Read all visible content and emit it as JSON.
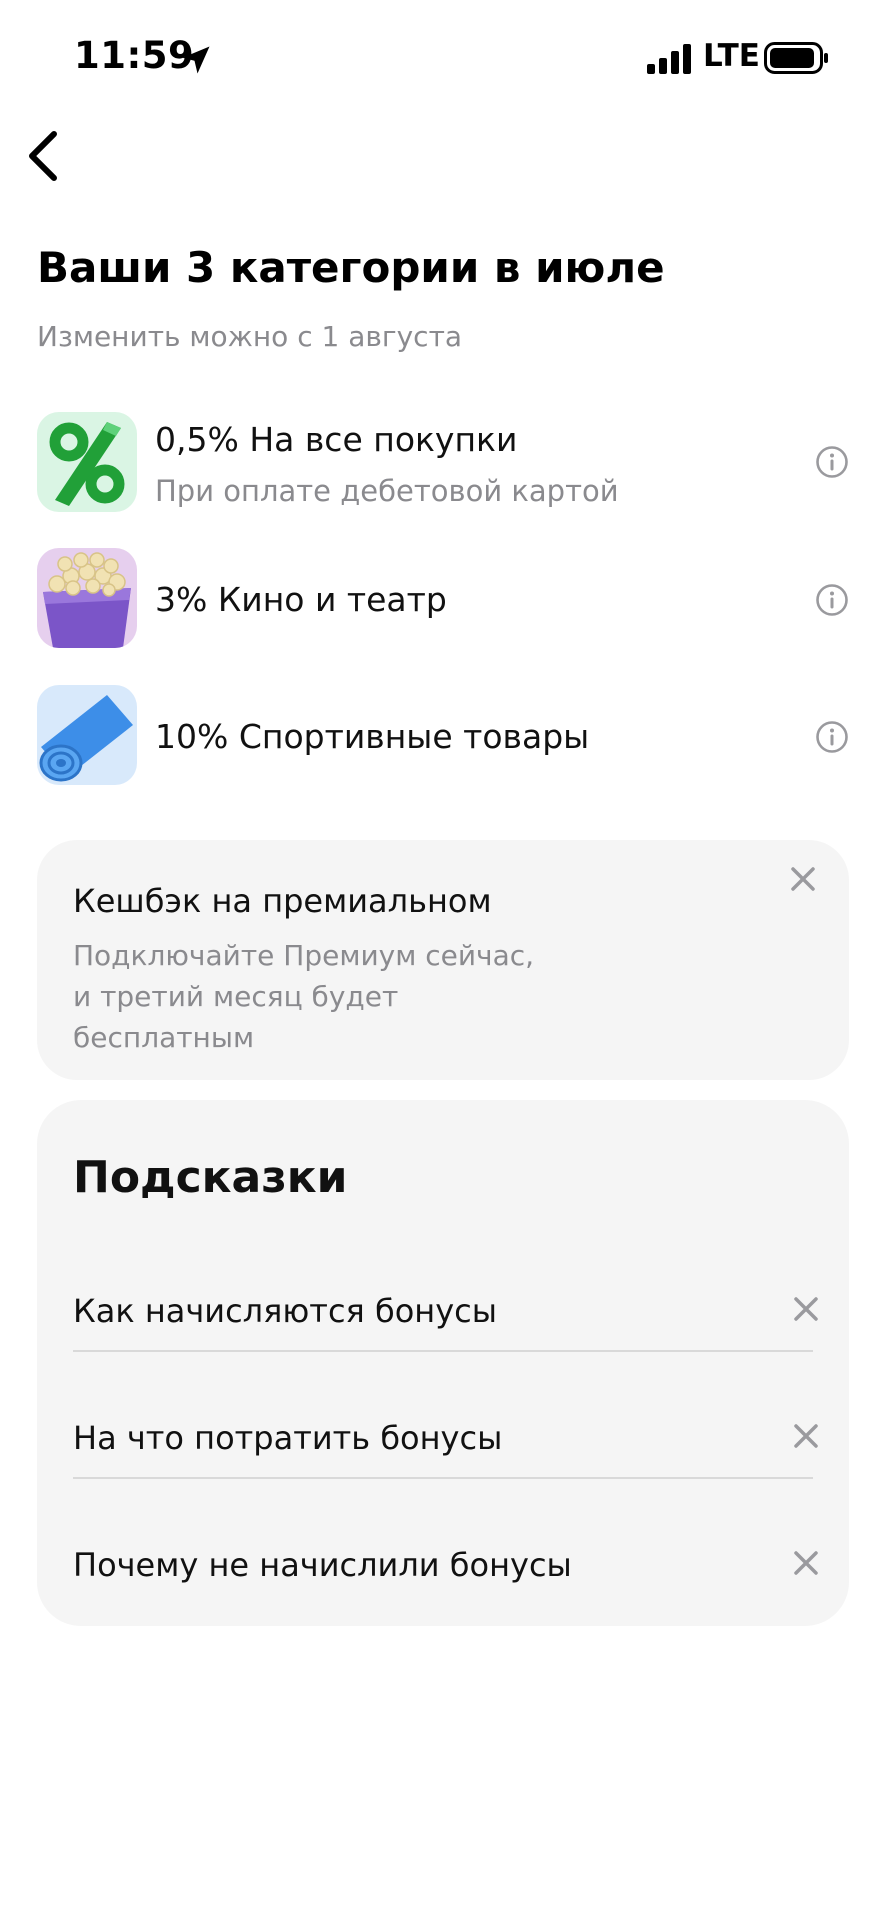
{
  "status_bar": {
    "time": "11:59",
    "network": "LTE",
    "icons": [
      "location-arrow-icon",
      "signal-icon",
      "battery-icon"
    ]
  },
  "header": {
    "back_icon": "chevron-left-icon",
    "title": "Ваши 3 категории в июле",
    "subtitle": "Изменить можно с 1 августа"
  },
  "categories": [
    {
      "title": "0,5% На все покупки",
      "subtitle": "При оплате дебетовой картой",
      "image": "percent-image",
      "info_icon": "info-icon"
    },
    {
      "title": "3% Кино и театр",
      "subtitle": "",
      "image": "popcorn-image",
      "info_icon": "info-icon"
    },
    {
      "title": "10% Спортивные товары",
      "subtitle": "",
      "image": "sport-mat-image",
      "info_icon": "info-icon"
    }
  ],
  "promo": {
    "title": "Кешбэк на премиальном",
    "text_lines": [
      "Подключайте Премиум сейчас,",
      "и третий месяц будет",
      "бесплатным"
    ],
    "close_icon": "close-icon"
  },
  "tips": {
    "title": "Подсказки",
    "items": [
      {
        "label": "Как начисляются бонусы",
        "close_icon": "close-icon"
      },
      {
        "label": "На что потратить бонусы",
        "close_icon": "close-icon"
      },
      {
        "label": "Почему не начислили бонусы",
        "close_icon": "close-icon"
      }
    ]
  },
  "colors": {
    "background": "#ffffff",
    "card": "#f5f5f5",
    "secondary_text": "#8a8a8e",
    "icon_gray": "#9a9a9e",
    "percent_green": "#21a038",
    "popcorn_purple": "#7b55c8",
    "mat_blue": "#3d8ee8"
  }
}
